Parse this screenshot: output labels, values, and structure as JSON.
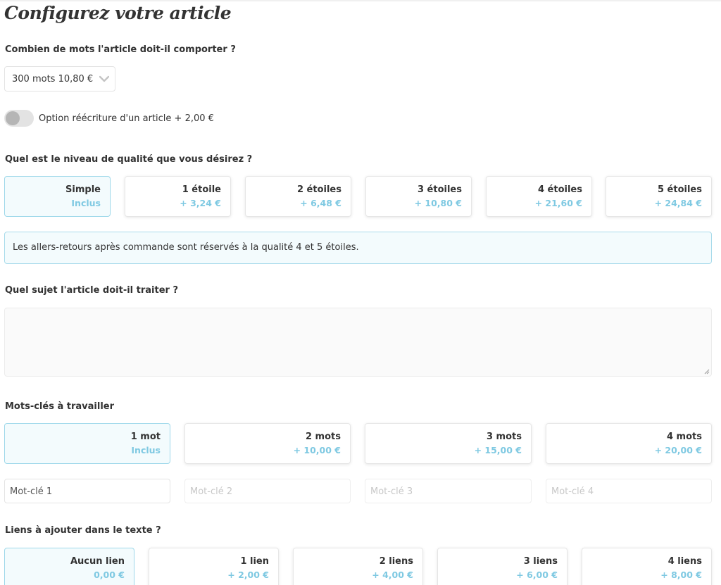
{
  "page_title": "Configurez votre article",
  "words": {
    "label": "Combien de mots l'article doit-il comporter ?",
    "selected": "300 mots 10,80 €"
  },
  "rewrite_option": {
    "label": "Option réécriture d'un article + 2,00 €",
    "enabled": false
  },
  "quality": {
    "label": "Quel est le niveau de qualité que vous désirez ?",
    "options": [
      {
        "title": "Simple",
        "price": "Inclus",
        "selected": true
      },
      {
        "title": "1 étoile",
        "price": "+ 3,24 €",
        "selected": false
      },
      {
        "title": "2 étoiles",
        "price": "+ 6,48 €",
        "selected": false
      },
      {
        "title": "3 étoiles",
        "price": "+ 10,80 €",
        "selected": false
      },
      {
        "title": "4 étoiles",
        "price": "+ 21,60 €",
        "selected": false
      },
      {
        "title": "5 étoiles",
        "price": "+ 24,84 €",
        "selected": false
      }
    ],
    "info": "Les allers-retours après commande sont réservés à la qualité 4 et 5 étoiles."
  },
  "subject": {
    "label": "Quel sujet l'article doit-il traiter ?",
    "value": ""
  },
  "keywords": {
    "label": "Mots-clés à travailler",
    "options": [
      {
        "title": "1 mot",
        "price": "Inclus",
        "selected": true
      },
      {
        "title": "2 mots",
        "price": "+ 10,00 €",
        "selected": false
      },
      {
        "title": "3 mots",
        "price": "+ 15,00 €",
        "selected": false
      },
      {
        "title": "4 mots",
        "price": "+ 20,00 €",
        "selected": false
      }
    ],
    "inputs": [
      {
        "value": "Mot-clé 1",
        "placeholder": "Mot-clé 1"
      },
      {
        "value": "",
        "placeholder": "Mot-clé 2"
      },
      {
        "value": "",
        "placeholder": "Mot-clé 3"
      },
      {
        "value": "",
        "placeholder": "Mot-clé 4"
      }
    ]
  },
  "links": {
    "label": "Liens à ajouter dans le texte ?",
    "options": [
      {
        "title": "Aucun lien",
        "price": "0,00 €",
        "selected": true
      },
      {
        "title": "1 lien",
        "price": "+ 2,00 €",
        "selected": false
      },
      {
        "title": "2 liens",
        "price": "+ 4,00 €",
        "selected": false
      },
      {
        "title": "3 liens",
        "price": "+ 6,00 €",
        "selected": false
      },
      {
        "title": "4 liens",
        "price": "+ 8,00 €",
        "selected": false
      }
    ]
  },
  "colors": {
    "accent": "#7fc9e2",
    "selected_bg": "#f3fbfd",
    "selected_border": "#9ed8ea"
  }
}
